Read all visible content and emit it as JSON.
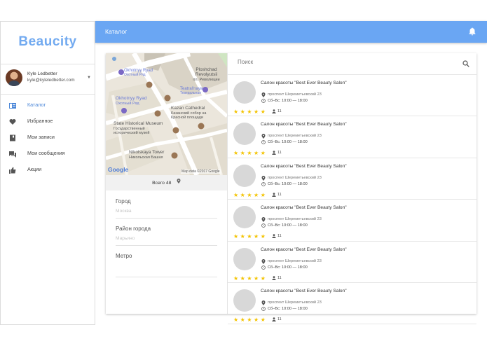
{
  "app": {
    "logo": "Beaucity"
  },
  "user": {
    "name": "Kyle Ledbetter",
    "email": "kyle@kyleledbetter.com",
    "caret": "▼"
  },
  "sidebar": {
    "items": [
      {
        "label": "Каталог",
        "icon": "catalog-icon",
        "active": true
      },
      {
        "label": "Избранное",
        "icon": "heart-icon",
        "active": false
      },
      {
        "label": "Мои записи",
        "icon": "bookmark-icon",
        "active": false
      },
      {
        "label": "Мои сообщения",
        "icon": "messages-icon",
        "active": false
      },
      {
        "label": "Акции",
        "icon": "thumb-up-icon",
        "active": false
      }
    ]
  },
  "header": {
    "title": "Каталог",
    "icon": "bell-icon"
  },
  "map": {
    "labels": [
      "Okhotnyy Ryad",
      "Охотный Ряд",
      "Ploshchad Revolyutsii",
      "пл. Революции",
      "Teatral'naya",
      "Театральная",
      "Okhotnyy Ryad",
      "Охотный Ряд",
      "Kazan Cathedral",
      "Казанский собор на",
      "Красной площади",
      "State Historical Museum",
      "Государственный",
      "исторический музей",
      "Nikolskaya Tower",
      "Никольская Башня"
    ],
    "google": "Google",
    "credit": "Map data ©2017 Google"
  },
  "total": {
    "label": "Всего 48"
  },
  "filters": [
    {
      "label": "Город",
      "value": "Москва"
    },
    {
      "label": "Район города",
      "value": "Марьино"
    },
    {
      "label": "Метро",
      "value": ""
    }
  ],
  "search": {
    "placeholder": "Поиск"
  },
  "items": [
    {
      "title": "Салон красоты \"Best Ever Beauty Salon\"",
      "address": "проспект Шереметьевский 23",
      "hours": "Сб–Вс:  10:00 — 18:00",
      "rating": 5,
      "stars": "★★★★★",
      "reviews": "11"
    },
    {
      "title": "Салон красоты \"Best Ever Beauty Salon\"",
      "address": "проспект Шереметьевский 23",
      "hours": "Сб–Вс:  10:00 — 18:00",
      "rating": 5,
      "stars": "★★★★★",
      "reviews": "11"
    },
    {
      "title": "Салон красоты \"Best Ever Beauty Salon\"",
      "address": "проспект Шереметьевский 23",
      "hours": "Сб–Вс:  10:00 — 18:00",
      "rating": 5,
      "stars": "★★★★★",
      "reviews": "11"
    },
    {
      "title": "Салон красоты \"Best Ever Beauty Salon\"",
      "address": "проспект Шереметьевский 23",
      "hours": "Сб–Вс:  10:00 — 18:00",
      "rating": 5,
      "stars": "★★★★★",
      "reviews": "11"
    },
    {
      "title": "Салон красоты \"Best Ever Beauty Salon\"",
      "address": "проспект Шереметьевский 23",
      "hours": "Сб–Вс:  10:00 — 18:00",
      "rating": 5,
      "stars": "★★★★★",
      "reviews": "11"
    },
    {
      "title": "Салон красоты \"Best Ever Beauty Salon\"",
      "address": "проспект Шереметьевский 23",
      "hours": "Сб–Вс:  10:00 — 18:00",
      "rating": 5,
      "stars": "★★★★★",
      "reviews": "11"
    }
  ],
  "colors": {
    "accent": "#6aa6f3",
    "logo": "#72aaf0",
    "star": "#f3c300",
    "active_nav": "#4a86d8"
  }
}
